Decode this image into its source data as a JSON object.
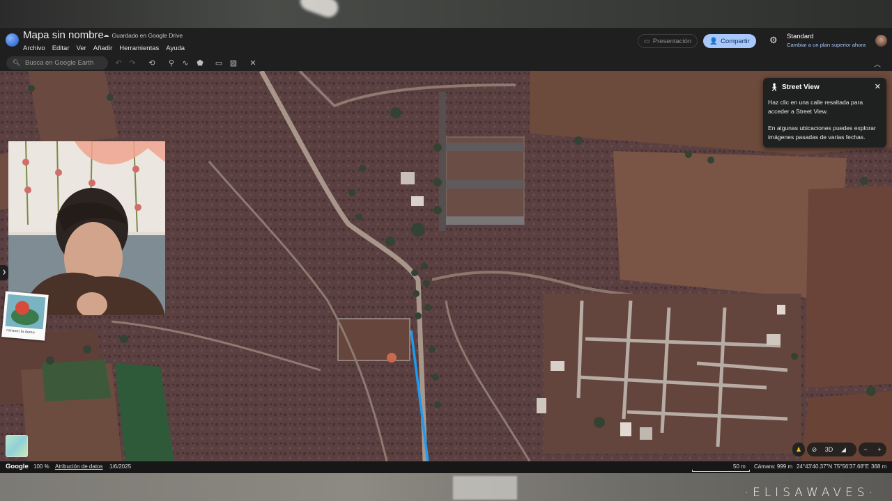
{
  "header": {
    "title": "Mapa sin nombre",
    "saved_status": "Guardado en Google Drive",
    "menu": [
      "Archivo",
      "Editar",
      "Ver",
      "Añadir",
      "Herramientas",
      "Ayuda"
    ],
    "present_label": "Presentación",
    "share_label": "Compartir",
    "plan_title": "Standard",
    "plan_link": "Cambiar a un plan superior ahora"
  },
  "toolbar": {
    "search_placeholder": "Busca en Google Earth",
    "tools": [
      "undo-icon",
      "redo-icon",
      "history-icon",
      "placemark-icon",
      "path-icon",
      "polygon-icon",
      "measure-icon",
      "image-overlay-icon",
      "tools-icon"
    ]
  },
  "street_view": {
    "title": "Street View",
    "line1": "Haz clic en una calle resaltada para acceder a Street View.",
    "line2": "En algunas ubicaciones puedes explorar imágenes pasadas de varias fechas."
  },
  "map_controls": {
    "labels": [
      "3D"
    ]
  },
  "status": {
    "brand": "Google",
    "zoom": "100 %",
    "data_attribution": "Atribución de datos",
    "date": "1/6/2025",
    "scale": "50 m",
    "camera": "Cámara: 999 m",
    "coords": "24°43'40.37\"N 75°56'37.68\"E",
    "elevation": "368 m"
  },
  "overlay": {
    "sticker_caption": "carmen la demo",
    "watermark": "·ELISAWAVES·"
  },
  "colors": {
    "accent": "#a8c7fa",
    "streetview_highlight": "#1e9bf0",
    "chrome": "#1e1f1e"
  }
}
